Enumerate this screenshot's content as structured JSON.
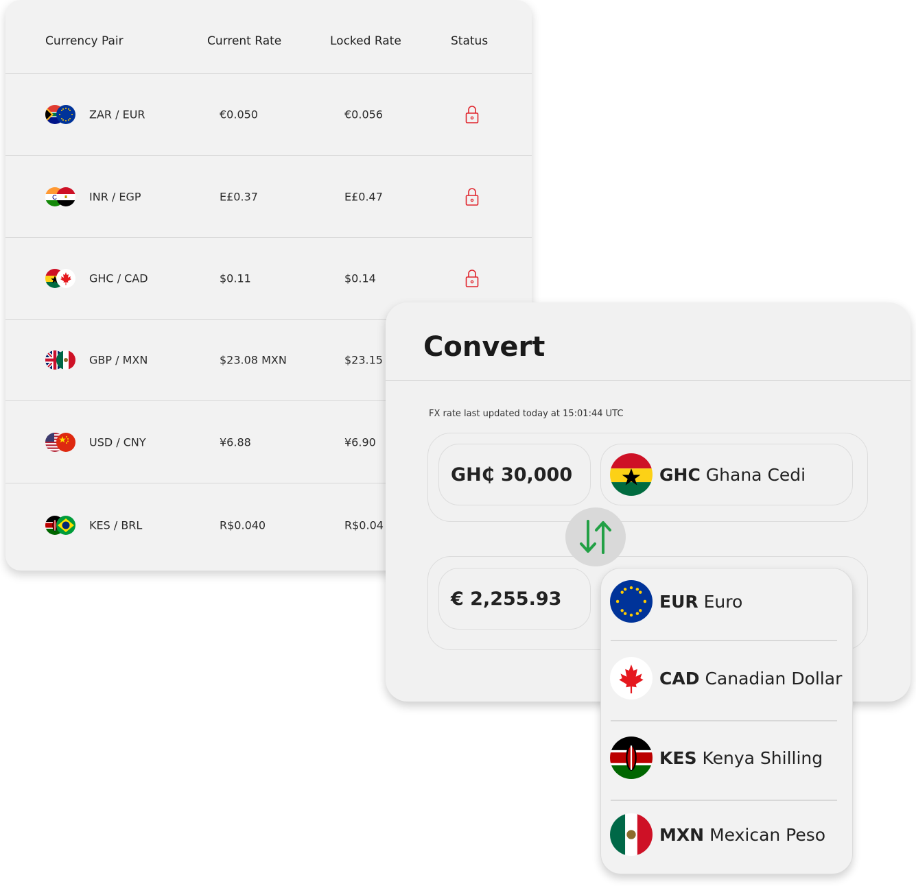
{
  "table": {
    "headers": [
      "Currency Pair",
      "Current Rate",
      "Locked Rate",
      "Status"
    ],
    "rows": [
      {
        "pair": "ZAR / EUR",
        "flags": [
          "za-flag",
          "eu-flag"
        ],
        "current": "€0.050",
        "locked": "€0.056",
        "status": "locked"
      },
      {
        "pair": "INR / EGP",
        "flags": [
          "in-flag",
          "eg-flag"
        ],
        "current": "E£0.37",
        "locked": "E£0.47",
        "status": "locked"
      },
      {
        "pair": "GHC / CAD",
        "flags": [
          "gh-flag",
          "ca-flag"
        ],
        "current": "$0.11",
        "locked": "$0.14",
        "status": "locked"
      },
      {
        "pair": "GBP / MXN",
        "flags": [
          "gb-flag",
          "mx-flag"
        ],
        "current": "$23.08 MXN",
        "locked": "$23.15",
        "status": ""
      },
      {
        "pair": "USD / CNY",
        "flags": [
          "us-flag",
          "cn-flag"
        ],
        "current": "¥6.88",
        "locked": "¥6.90",
        "status": ""
      },
      {
        "pair": "KES / BRL",
        "flags": [
          "ke-flag",
          "br-flag"
        ],
        "current": "R$0.040",
        "locked": "R$0.04",
        "status": ""
      }
    ],
    "lock_color": "#e0232b"
  },
  "convert": {
    "title": "Convert",
    "fx_note": "FX rate last updated today at 15:01:44 UTC",
    "from": {
      "amount": "GH₵ 30,000",
      "code": "GHC",
      "name": "Ghana Cedi"
    },
    "to": {
      "amount": "€ 2,255.93",
      "code": "EUR",
      "name": "Euro"
    },
    "swap_icon": "swap-vertical-arrows-icon",
    "swap_color": "#22a045",
    "dropdown": [
      {
        "code": "EUR",
        "name": "Euro"
      },
      {
        "code": "CAD",
        "name": "Canadian Dollar"
      },
      {
        "code": "KES",
        "name": "Kenya Shilling"
      },
      {
        "code": "MXN",
        "name": "Mexican Peso"
      }
    ]
  }
}
